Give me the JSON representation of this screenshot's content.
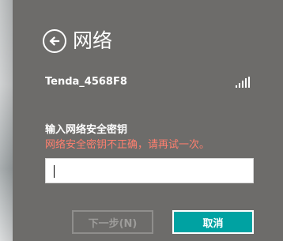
{
  "colors": {
    "panel_bg": "#6d6c6a",
    "error_text": "#ff7f6e",
    "accent": "#00a2a2",
    "disabled_text": "#9d9c9a"
  },
  "header": {
    "back_icon": "back-arrow-icon",
    "title": "网络"
  },
  "network": {
    "ssid": "Tenda_4568F8",
    "signal_icon": "wifi-signal-icon"
  },
  "security": {
    "label": "输入网络安全密钥",
    "error": "网络安全密钥不正确，请再试一次。",
    "input_value": ""
  },
  "buttons": {
    "next": "下一步(N)",
    "cancel": "取消"
  }
}
